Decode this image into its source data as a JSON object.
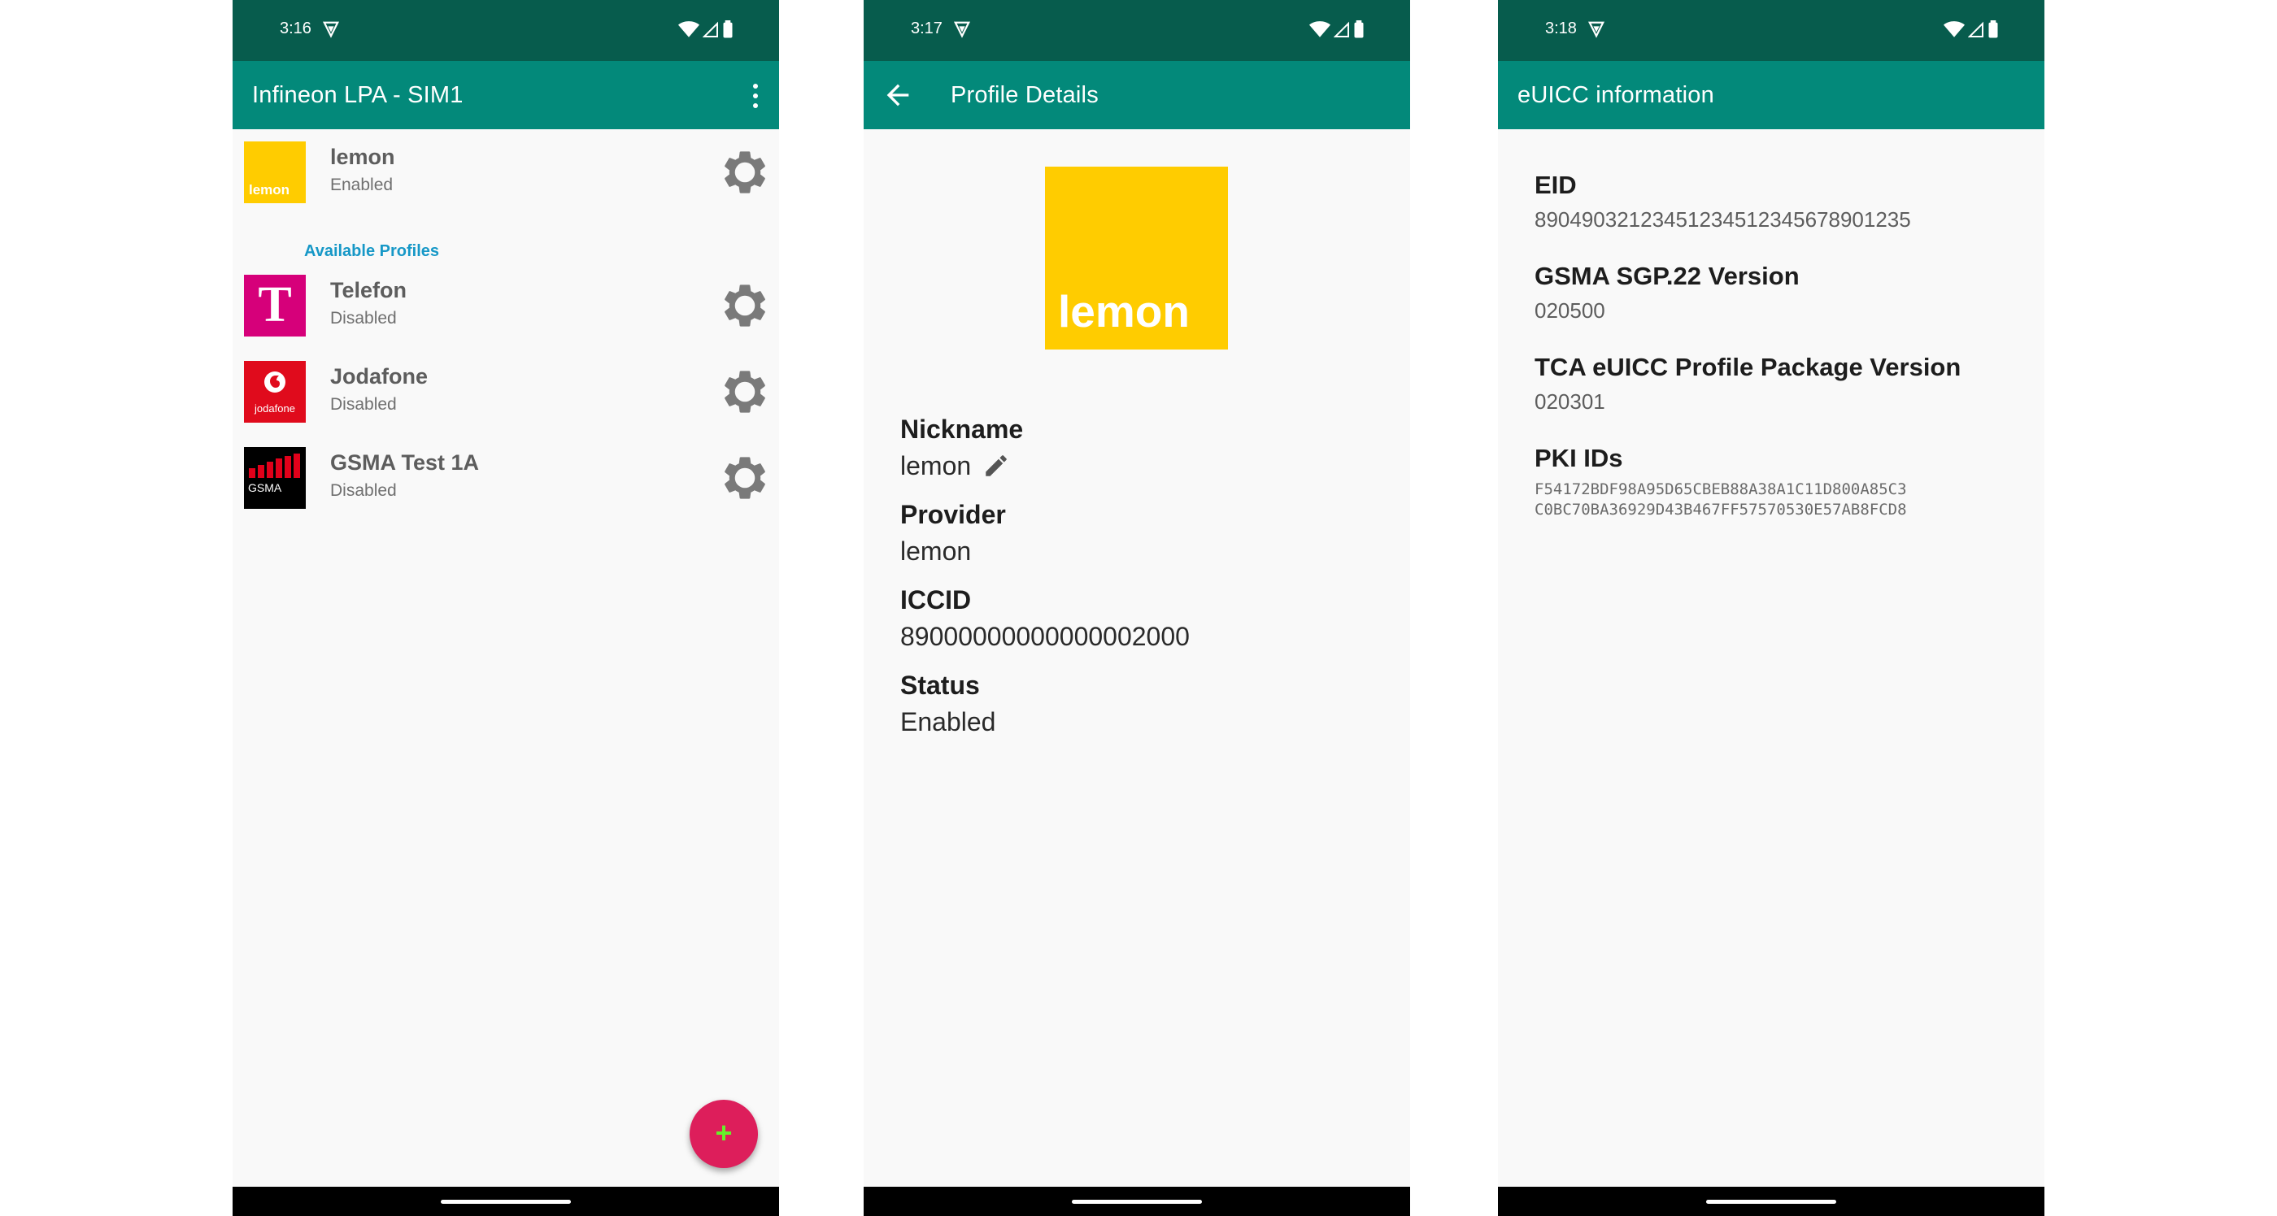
{
  "phone1": {
    "status_time": "3:16",
    "title": "Infineon LPA - SIM1",
    "enabled_profile": {
      "logo_text": "lemon",
      "name": "lemon",
      "status": "Enabled"
    },
    "section_header": "Available Profiles",
    "profiles": [
      {
        "logo_text": "T",
        "name": "Telefon",
        "status": "Disabled"
      },
      {
        "logo_text": "jodafone",
        "name": "Jodafone",
        "status": "Disabled"
      },
      {
        "logo_text": "GSMA",
        "name": "GSMA Test 1A",
        "status": "Disabled"
      }
    ],
    "fab_label": "+"
  },
  "phone2": {
    "status_time": "3:17",
    "title": "Profile Details",
    "logo_text": "lemon",
    "fields": [
      {
        "label": "Nickname",
        "value": "lemon"
      },
      {
        "label": "Provider",
        "value": "lemon"
      },
      {
        "label": "ICCID",
        "value": "89000000000000002000"
      },
      {
        "label": "Status",
        "value": "Enabled"
      }
    ]
  },
  "phone3": {
    "status_time": "3:18",
    "title": "eUICC information",
    "fields": [
      {
        "label": "EID",
        "value": "89049032123451234512345678901235"
      },
      {
        "label": "GSMA SGP.22 Version",
        "value": "020500"
      },
      {
        "label": "TCA eUICC Profile Package Version",
        "value": "020301"
      },
      {
        "label": "PKI IDs",
        "value_lines": [
          "F54172BDF98A95D65CBEB88A38A1C11D800A85C3",
          "C0BC70BA36929D43B467FF57570530E57AB8FCD8"
        ]
      }
    ]
  },
  "colors": {
    "status_bar": "#075c4d",
    "app_bar": "#03897a",
    "accent_link": "#1798c7",
    "fab": "#dd1e5b",
    "lemon": "#ffcc00",
    "telefon": "#d6007a",
    "jodafone": "#e00b1c"
  },
  "icons": [
    "vpn-key-icon",
    "wifi-icon",
    "signal-icon",
    "battery-icon",
    "overflow-menu-icon",
    "settings-gear-icon",
    "back-arrow-icon",
    "edit-pencil-icon",
    "add-icon"
  ]
}
